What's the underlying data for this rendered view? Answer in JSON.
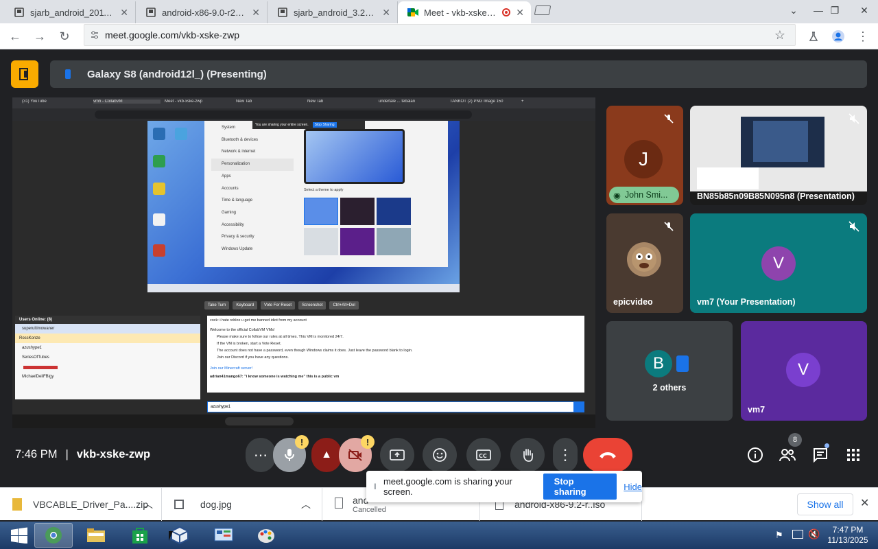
{
  "browser": {
    "tabs": [
      {
        "title": "sjarb_android_2011082",
        "active": false
      },
      {
        "title": "android-x86-9.0-r2_202",
        "active": false
      },
      {
        "title": "sjarb_android_3.2RC2 d",
        "active": false
      },
      {
        "title": "Meet - vkb-xske-zwp",
        "active": true
      }
    ],
    "url": "meet.google.com/vkb-xske-zwp"
  },
  "meet": {
    "presenting_label": "Galaxy S8 (android12l_) (Presenting)",
    "time": "7:46 PM",
    "meeting_code": "vkb-xske-zwp",
    "participants_count": "8",
    "tiles": [
      {
        "name": "John Smi...",
        "initial": "J",
        "color": "#8a3a1c"
      },
      {
        "name": "BN85b85n09B85N095n8 (Presentation)"
      },
      {
        "name": "epicvideo"
      },
      {
        "name": "vm7 (Your Presentation)",
        "initial": "V",
        "color": "#0b7b7e"
      },
      {
        "name": "2 others",
        "initial": "B"
      },
      {
        "name": "vm7",
        "initial": "V",
        "color": "#6a2fb5"
      }
    ],
    "notification": {
      "text": "meet.google.com is sharing your screen.",
      "stop": "Stop sharing",
      "hide": "Hide"
    }
  },
  "shared": {
    "tabs": [
      "(31) YouTube",
      "vmh - CollabVM",
      "Meet - vkb-xske-zwp",
      "New Tab",
      "New Tab",
      "undertale ... tebalan",
      "TANKOT (2) PNG Image 150",
      "+"
    ],
    "settings_items": [
      "System",
      "Bluetooth & devices",
      "Network & internet",
      "Personalization",
      "Apps",
      "Accounts",
      "Time & language",
      "Gaming",
      "Accessibility",
      "Privacy & security",
      "Windows Update"
    ],
    "theme_label": "Select a theme to apply",
    "sharing_banner": "You are sharing your entire screen.",
    "stop_banner": "Stop Sharing",
    "vm_buttons": [
      "Take Turn",
      "Keyboard",
      "Vote For Reset",
      "Screenshot",
      "Ctrl+Alt+Del"
    ],
    "users_header": "Users Online: (8)",
    "users": [
      "superultimowaner",
      "RossKonze",
      "azushype1",
      "SeriesOfTubes",
      "",
      "MichaelDeilFBigy"
    ],
    "chat": [
      "cock: i hate roblox u get me banned idiot from my account",
      "Welcome to the official CollabVM VMs!",
      "Please make sure to follow our rules at all times. This VM is monitored 24/7.",
      "If the VM is broken, start a Vote Reset.",
      "The account does not have a password, even though Windows claims it does. Just leave the password blank to login.",
      "Join our Discord if you have any questions.",
      "Join our Minecraft server!",
      "adrian41mango67: \"i know someone is watching me\" this is a public vm"
    ],
    "chat_user": "azushype1"
  },
  "downloads": [
    {
      "name": "VBCABLE_Driver_Pa....zip"
    },
    {
      "name": "dog.jpg"
    },
    {
      "name": "and",
      "status": "Cancelled"
    },
    {
      "name": "android-x86-9.2-r..iso"
    }
  ],
  "downloads_show_all": "Show all",
  "taskbar": {
    "time": "7:47 PM",
    "date": "11/13/2025"
  }
}
